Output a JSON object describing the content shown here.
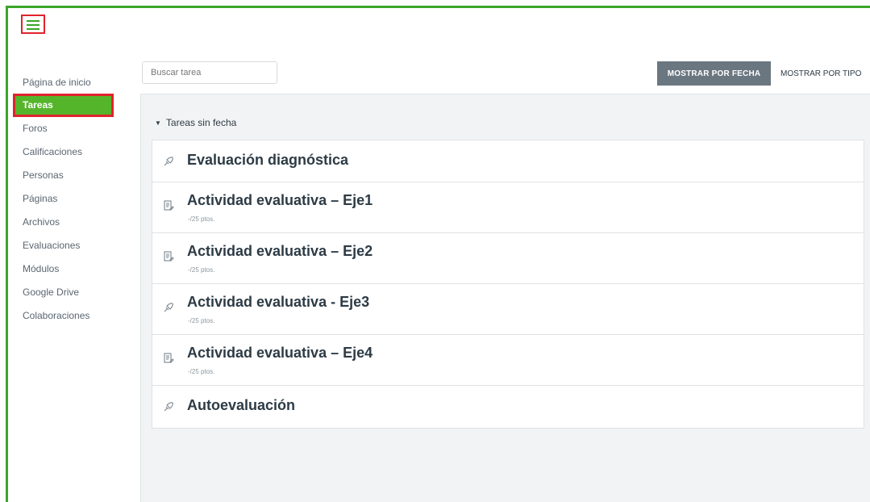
{
  "sidebar": {
    "items": [
      {
        "label": "Página de inicio"
      },
      {
        "label": "Tareas",
        "active": true
      },
      {
        "label": "Foros"
      },
      {
        "label": "Calificaciones"
      },
      {
        "label": "Personas"
      },
      {
        "label": "Páginas"
      },
      {
        "label": "Archivos"
      },
      {
        "label": "Evaluaciones"
      },
      {
        "label": "Módulos"
      },
      {
        "label": "Google Drive"
      },
      {
        "label": "Colaboraciones"
      }
    ]
  },
  "toolbar": {
    "search_placeholder": "Buscar tarea",
    "show_by_date_label": "MOSTRAR POR FECHA",
    "show_by_type_label": "MOSTRAR POR TIPO"
  },
  "group": {
    "label": "Tareas sin fecha",
    "items": [
      {
        "title": "Evaluación diagnóstica",
        "icon": "quiz-rocket-icon",
        "points": ""
      },
      {
        "title": "Actividad evaluativa – Eje1",
        "icon": "assignment-icon",
        "points": "-/25 ptos."
      },
      {
        "title": "Actividad evaluativa – Eje2",
        "icon": "assignment-icon",
        "points": "-/25 ptos."
      },
      {
        "title": "Actividad evaluativa - Eje3",
        "icon": "quiz-rocket-icon",
        "points": "-/25 ptos."
      },
      {
        "title": "Actividad evaluativa – Eje4",
        "icon": "assignment-icon",
        "points": "-/25 ptos."
      },
      {
        "title": "Autoevaluación",
        "icon": "quiz-rocket-icon",
        "points": ""
      }
    ]
  },
  "colors": {
    "accent_green": "#55b52a",
    "highlight_red": "#e0232b",
    "button_gray": "#6b7780"
  }
}
